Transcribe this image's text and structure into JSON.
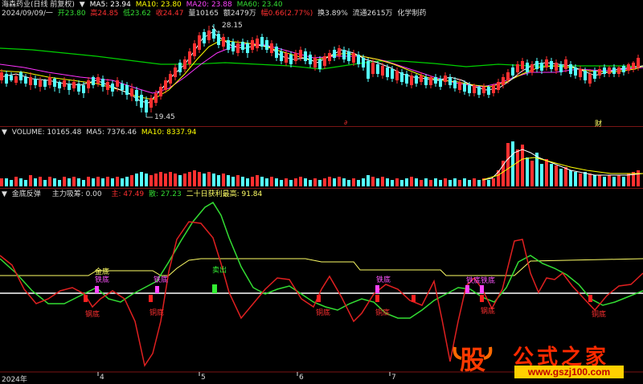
{
  "colors": {
    "background": "#000000",
    "up": "#ff3030",
    "down": "#54ffff",
    "ma5": "#ffffff",
    "ma10": "#ffff00",
    "ma20": "#ff00ff",
    "ma60": "#00e000",
    "grid": "#7a1515",
    "green_line": "#33dd33",
    "red_line": "#e02020",
    "yellow_line": "#ffff66"
  },
  "price_panel": {
    "title": "海森药业(日线 前复权)",
    "ma5": "MA5: 23.94",
    "ma10": "MA10: 23.80",
    "ma20": "MA20: 23.88",
    "ma60": "MA60: 23.40",
    "date": "2024/09/09/一",
    "open": "开23.80",
    "high": "高24.85",
    "low": "低23.62",
    "close": "收24.47",
    "volume": "量10165",
    "amount": "额2479万",
    "change": "幅0.66(2.77%)",
    "turnover": "换3.89%",
    "float_cap": "流通2615万",
    "industry": "化学制药",
    "max_label": "28.15",
    "min_label": "19.45",
    "event_marker_1": "∂",
    "event_marker_2": "财"
  },
  "volume_panel": {
    "volume": "VOLUME: 10165.48",
    "ma5": "MA5: 7376.46",
    "ma10": "MA10: 8337.94"
  },
  "indicator_panel": {
    "name": "金底反弹",
    "main_fund": "主力吸筹: 0.00",
    "zhu": "主: 47.49",
    "san": "散: 27.23",
    "profit_high": "二十日获利最高: 91.84",
    "labels": [
      "金底",
      "铁底",
      "铁底",
      "卖出",
      "铁底",
      "铁底铁底",
      "钢底",
      "铜底",
      "铜底",
      "铜底",
      "钢底",
      "铜底"
    ]
  },
  "time_axis": {
    "labels": [
      "2024年",
      "4",
      "5",
      "6",
      "7"
    ]
  },
  "watermark": {
    "logo_char": "股",
    "brand": "公式之家",
    "url": "www.gszj100.com"
  }
}
